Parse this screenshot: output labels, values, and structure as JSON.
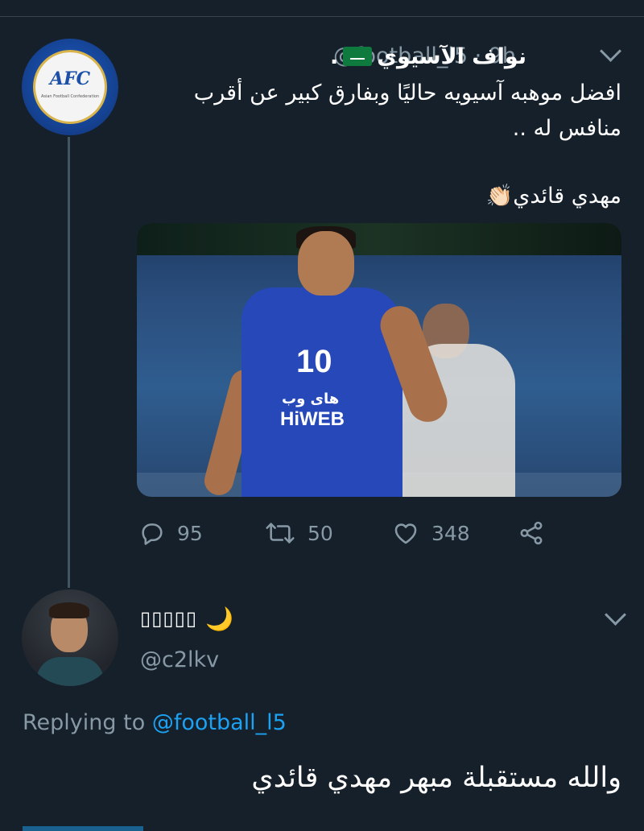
{
  "tweet": {
    "display_name": "نواف الآسيوي",
    "verified_mark": ".",
    "handle": "@football_l5",
    "time": "9h",
    "handle_time": "@football_l5 · 9h",
    "text_line1": "افضل موهبه آسيويه حاليًا وبفارق كبير عن أقرب منافس له ..",
    "text_line2": "مهدي قائدي",
    "clap_emoji": "👏🏻",
    "avatar_logo": "AFC",
    "avatar_logo_sub": "Asian Football Confederation",
    "media": {
      "jersey_number": "10",
      "sponsor_ar": "های وب",
      "sponsor_en": "HiWEB"
    },
    "actions": {
      "replies": "95",
      "retweets": "50",
      "likes": "348"
    },
    "icons": {
      "reply": "reply-icon",
      "retweet": "retweet-icon",
      "like": "heart-icon",
      "share": "share-icon",
      "menu": "chevron-down-icon"
    }
  },
  "reply": {
    "display_name": "▯▯▯▯▯",
    "name_emoji": "🌙",
    "handle": "@c2lkv",
    "replying_prefix": "Replying to",
    "replying_to": "@football_l5",
    "text": "والله مستقبلة مبهر مهدي قائدي"
  },
  "colors": {
    "background": "#15202b",
    "secondary_text": "#8899a6",
    "link": "#1da1f2",
    "thread_line": "#425563"
  }
}
